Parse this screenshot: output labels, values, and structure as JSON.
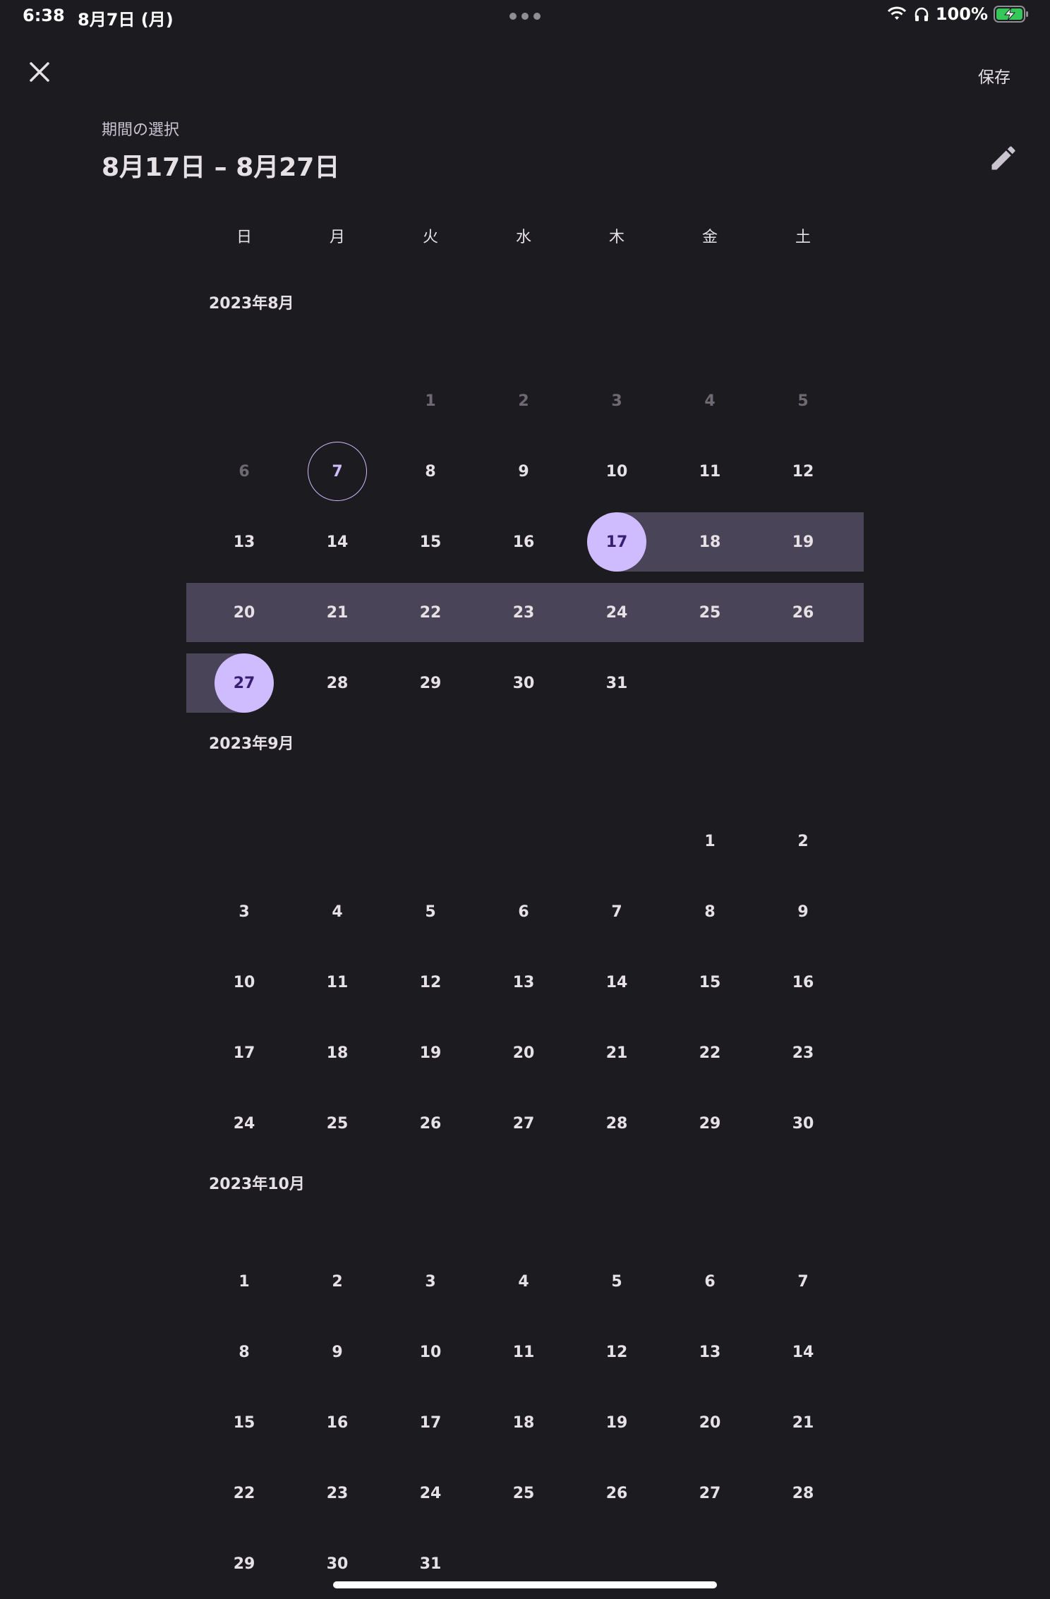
{
  "status_bar": {
    "time": "6:38",
    "date": "8月7日 (月)",
    "battery": "100%"
  },
  "header": {
    "save_label": "保存",
    "subtitle": "期間の選択",
    "range_title": "8月17日 – 8月27日"
  },
  "weekdays": [
    "日",
    "月",
    "火",
    "水",
    "木",
    "金",
    "土"
  ],
  "months": [
    {
      "label": "2023年8月",
      "weeks": [
        [
          "",
          "",
          "1",
          "2",
          "3",
          "4",
          "5"
        ],
        [
          "6",
          "7",
          "8",
          "9",
          "10",
          "11",
          "12"
        ],
        [
          "13",
          "14",
          "15",
          "16",
          "17",
          "18",
          "19"
        ],
        [
          "20",
          "21",
          "22",
          "23",
          "24",
          "25",
          "26"
        ],
        [
          "27",
          "28",
          "29",
          "30",
          "31",
          "",
          ""
        ]
      ],
      "disabled_days": [
        "1",
        "2",
        "3",
        "4",
        "5",
        "6"
      ],
      "today": "7",
      "range_start": "17",
      "range_end": "27"
    },
    {
      "label": "2023年9月",
      "weeks": [
        [
          "",
          "",
          "",
          "",
          "",
          "1",
          "2"
        ],
        [
          "3",
          "4",
          "5",
          "6",
          "7",
          "8",
          "9"
        ],
        [
          "10",
          "11",
          "12",
          "13",
          "14",
          "15",
          "16"
        ],
        [
          "17",
          "18",
          "19",
          "20",
          "21",
          "22",
          "23"
        ],
        [
          "24",
          "25",
          "26",
          "27",
          "28",
          "29",
          "30"
        ]
      ]
    },
    {
      "label": "2023年10月",
      "weeks": [
        [
          "1",
          "2",
          "3",
          "4",
          "5",
          "6",
          "7"
        ],
        [
          "8",
          "9",
          "10",
          "11",
          "12",
          "13",
          "14"
        ],
        [
          "15",
          "16",
          "17",
          "18",
          "19",
          "20",
          "21"
        ],
        [
          "22",
          "23",
          "24",
          "25",
          "26",
          "27",
          "28"
        ],
        [
          "29",
          "30",
          "31",
          "",
          "",
          "",
          ""
        ]
      ]
    }
  ],
  "colors": {
    "background": "#1c1b1f",
    "accent": "#cfbcff",
    "range_band": "#4a4458",
    "on_accent": "#381e72"
  }
}
